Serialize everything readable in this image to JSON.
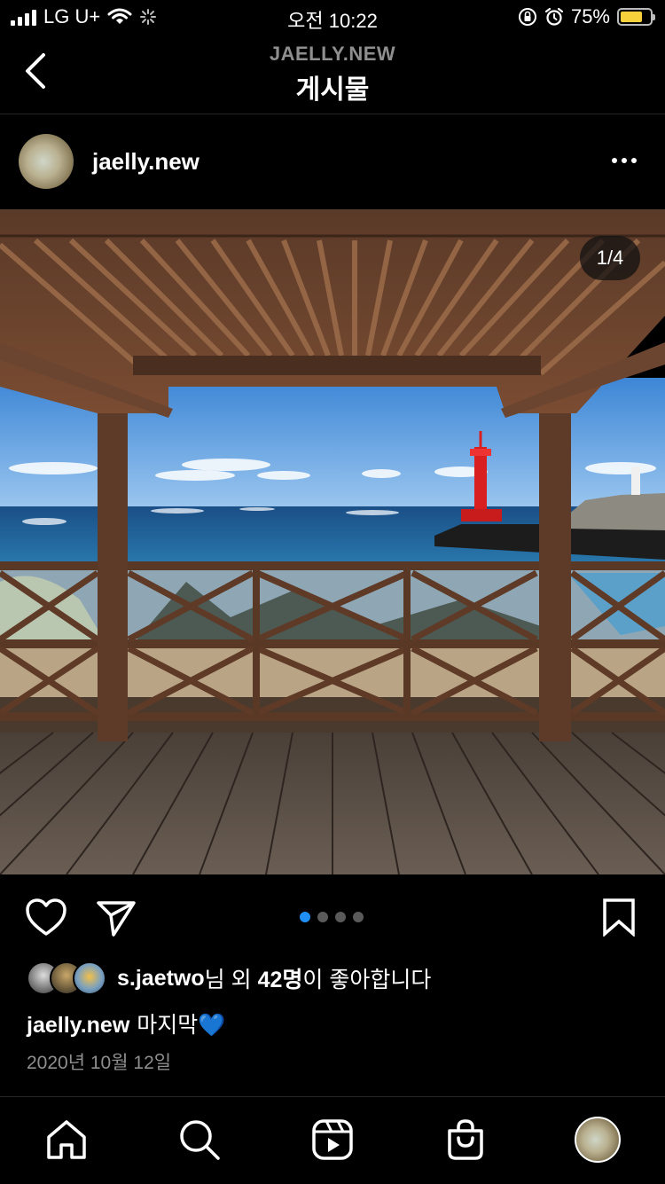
{
  "status_bar": {
    "carrier": "LG U+",
    "time": "오전 10:22",
    "battery_percent": "75%",
    "battery_level": 0.75
  },
  "header": {
    "subtitle": "JAELLY.NEW",
    "title": "게시물"
  },
  "post": {
    "username": "jaelly.new",
    "image_counter": "1/4",
    "image_index": 1,
    "image_total": 4
  },
  "likes": {
    "user": "s.jaetwo",
    "middle": "님 외 ",
    "count": "42명",
    "suffix": "이 좋아합니다"
  },
  "caption": {
    "username": "jaelly.new",
    "text": "마지막💙"
  },
  "date": "2020년 10월 12일",
  "icons": {
    "back": "chevron-left-icon",
    "more": "more-horizontal-icon",
    "like": "heart-icon",
    "share": "send-icon",
    "save": "bookmark-icon",
    "home": "home-icon",
    "search": "search-icon",
    "reels": "reels-icon",
    "shop": "shop-bag-icon"
  },
  "colors": {
    "background": "#000000",
    "active_dot": "#1f8ff5",
    "secondary_text": "#8e8e8e"
  }
}
